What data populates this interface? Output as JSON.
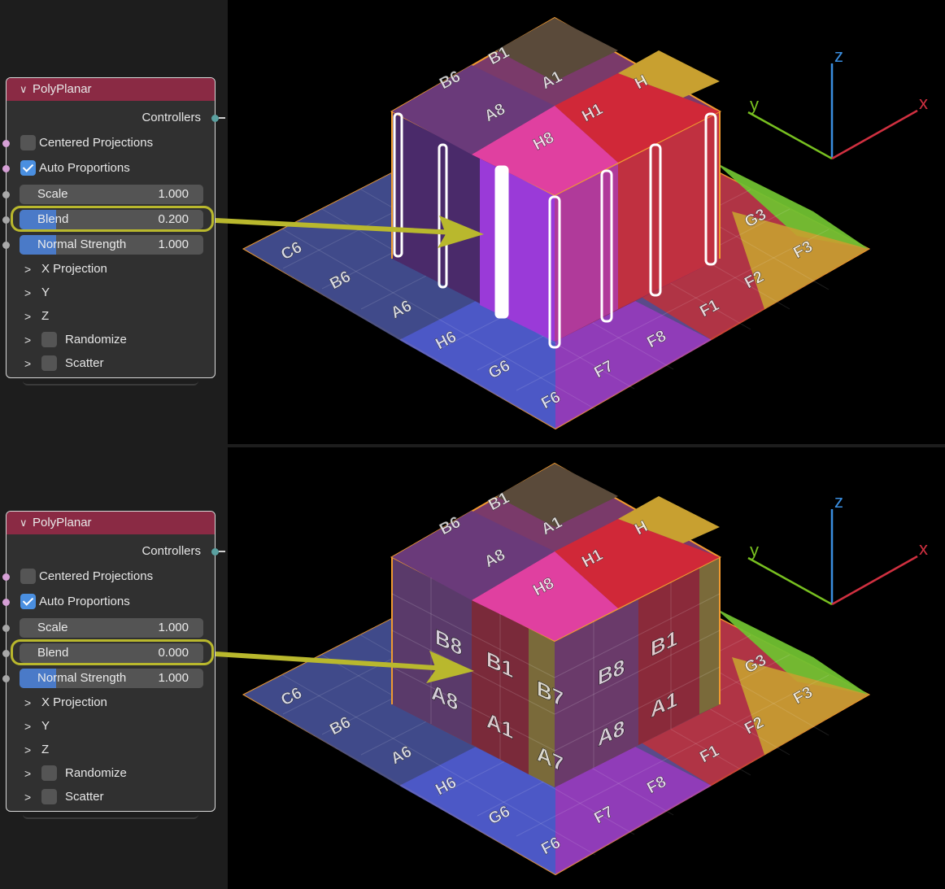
{
  "nodes": [
    {
      "title": "PolyPlanar",
      "controllers": "Controllers",
      "centered_label": "Centered Projections",
      "auto_label": "Auto Proportions",
      "auto_checked": true,
      "scale": {
        "label": "Scale",
        "value": "1.000",
        "fraction": 0.0
      },
      "blend": {
        "label": "Blend",
        "value": "0.200",
        "fraction": 0.2
      },
      "normal": {
        "label": "Normal Strength",
        "value": "1.000",
        "fraction": 0.2
      },
      "xproj": "X Projection",
      "y": "Y",
      "z": "Z",
      "randomize": "Randomize",
      "scatter": "Scatter"
    },
    {
      "title": "PolyPlanar",
      "controllers": "Controllers",
      "centered_label": "Centered Projections",
      "auto_label": "Auto Proportions",
      "auto_checked": true,
      "scale": {
        "label": "Scale",
        "value": "1.000",
        "fraction": 0.0
      },
      "blend": {
        "label": "Blend",
        "value": "0.000",
        "fraction": 0.0
      },
      "normal": {
        "label": "Normal Strength",
        "value": "1.000",
        "fraction": 0.2
      },
      "xproj": "X Projection",
      "y": "Y",
      "z": "Z",
      "randomize": "Randomize",
      "scatter": "Scatter"
    }
  ],
  "axes": {
    "x": "x",
    "y": "y",
    "z": "z",
    "x_color": "#d03040",
    "y_color": "#78c020",
    "z_color": "#3a8ee0"
  },
  "highlight_color": "#b9b82d",
  "floor_labels": [
    "C6",
    "B6",
    "A6",
    "H6",
    "G6",
    "F6",
    "F7",
    "F8",
    "F1",
    "F2",
    "F3",
    "G3"
  ],
  "top_labels": [
    "B1",
    "A1",
    "H",
    "B6",
    "A8",
    "H1",
    "H8"
  ],
  "cube_labels": [
    "B8",
    "A8",
    "B1",
    "A1",
    "B7",
    "A7",
    "B8",
    "A8",
    "B1",
    "A1"
  ]
}
